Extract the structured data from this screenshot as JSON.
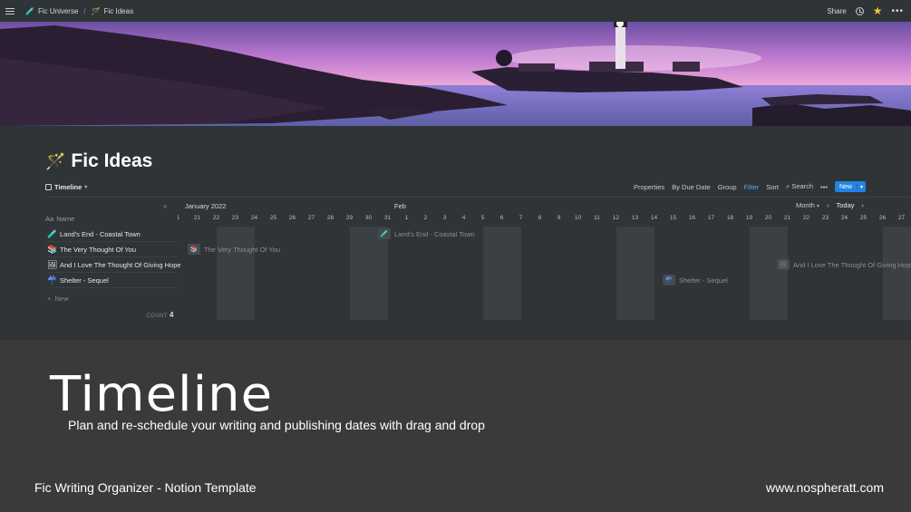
{
  "topbar": {
    "breadcrumb": [
      {
        "icon": "🧪",
        "label": "Fic Universe"
      },
      {
        "icon": "🪄",
        "label": "Fic Ideas"
      }
    ],
    "separator": "/",
    "share": "Share",
    "more": "•••"
  },
  "page": {
    "icon": "🪄",
    "title": "Fic Ideas"
  },
  "view": {
    "tab": "Timeline",
    "actions": {
      "properties": "Properties",
      "by_due_date": "By Due Date",
      "group": "Group",
      "filter": "Filter",
      "sort": "Sort",
      "search": "Search",
      "more": "•••",
      "new": "New"
    }
  },
  "table": {
    "collapse": "«",
    "column": "Name",
    "rows": [
      {
        "icon": "🧪",
        "name": "Land's End - Coastal Town"
      },
      {
        "icon": "📚",
        "name": "The Very Thought Of You"
      },
      {
        "icon": "🖼",
        "name": "And I Love The Thought Of Giving Hope"
      },
      {
        "icon": "☔",
        "name": "Shelter - Sequel"
      }
    ],
    "new_label": "New",
    "count_label": "COUNT",
    "count": "4"
  },
  "timeline": {
    "months": [
      {
        "label": "January 2022"
      },
      {
        "label": "Feb"
      }
    ],
    "view_mode": "Month",
    "today": "Today",
    "days": [
      "1",
      "21",
      "22",
      "23",
      "24",
      "25",
      "26",
      "27",
      "28",
      "29",
      "30",
      "31",
      "1",
      "2",
      "3",
      "4",
      "5",
      "6",
      "7",
      "8",
      "9",
      "10",
      "11",
      "12",
      "13",
      "14",
      "15",
      "16",
      "17",
      "18",
      "19",
      "20",
      "21",
      "22",
      "23",
      "24",
      "25",
      "26",
      "27"
    ],
    "bars": [
      {
        "label": "Land's End - Coastal Town",
        "icon": "🧪"
      },
      {
        "label": "The Very Thought Of You",
        "icon": "📚"
      },
      {
        "label": "And I Love The Thought Of Giving Hope",
        "icon": "🖼"
      },
      {
        "label": "Shelter - Sequel",
        "icon": "☔"
      }
    ]
  },
  "promo": {
    "heading": "Timeline",
    "subheading": "Plan and re-schedule your writing and publishing dates with drag and drop",
    "footer_left": "Fic Writing Organizer - Notion Template",
    "footer_right": "www.nospheratt.com"
  },
  "colors": {
    "accent": "#2383e2",
    "filter": "#5aa9e6",
    "star": "#f2c230"
  }
}
